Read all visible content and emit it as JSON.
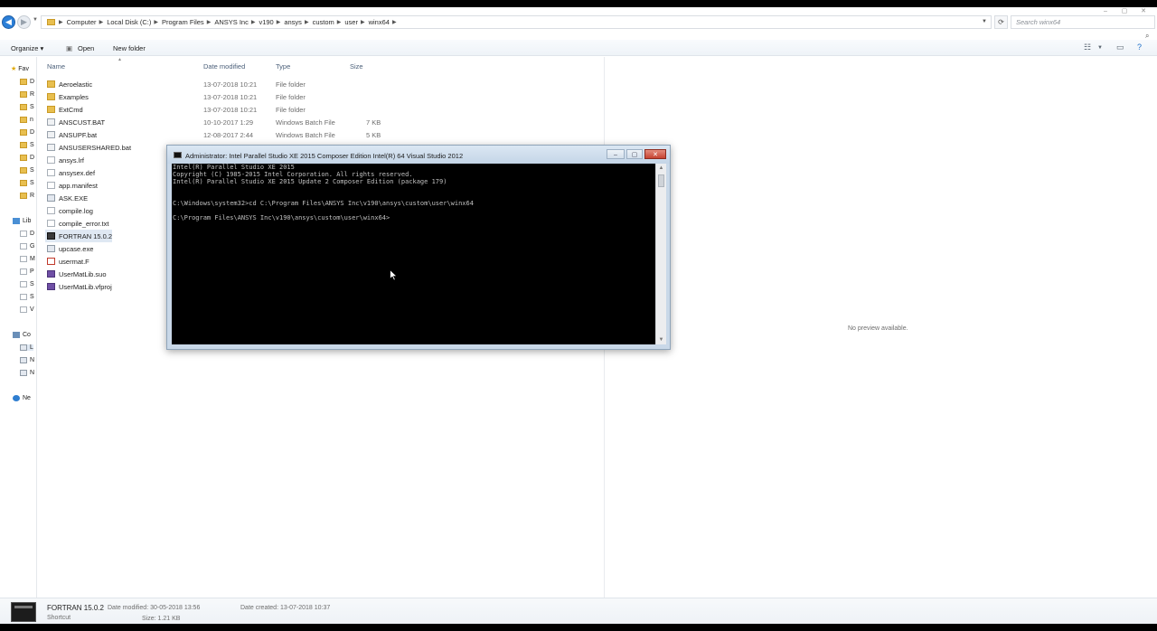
{
  "window": {
    "minimize": "–",
    "maximize": "▢",
    "close": "✕"
  },
  "breadcrumb": [
    "Computer",
    "Local Disk (C:)",
    "Program Files",
    "ANSYS Inc",
    "v190",
    "ansys",
    "custom",
    "user",
    "winx64"
  ],
  "search": {
    "placeholder": "Search winx64"
  },
  "toolbar": {
    "organize": "Organize ▾",
    "open": "Open",
    "new_folder": "New folder"
  },
  "nav_pane": [
    "Fav",
    "D",
    "R",
    "S",
    "n",
    "D",
    "S",
    "D",
    "S",
    "S",
    "R",
    "Lib",
    "D",
    "G",
    "M",
    "P",
    "S",
    "S",
    "V",
    "Co",
    "L",
    "N",
    "N",
    "Ne"
  ],
  "columns": {
    "name": "Name",
    "date": "Date modified",
    "type": "Type",
    "size": "Size"
  },
  "files": [
    {
      "name": "Aeroelastic",
      "date": "13-07-2018 10:21",
      "type": "File folder",
      "size": "",
      "icon": "folder"
    },
    {
      "name": "Examples",
      "date": "13-07-2018 10:21",
      "type": "File folder",
      "size": "",
      "icon": "folder"
    },
    {
      "name": "ExtCmd",
      "date": "13-07-2018 10:21",
      "type": "File folder",
      "size": "",
      "icon": "folder"
    },
    {
      "name": "ANSCUST.BAT",
      "date": "10-10-2017 1:29",
      "type": "Windows Batch File",
      "size": "7 KB",
      "icon": "bat"
    },
    {
      "name": "ANSUPF.bat",
      "date": "12-08-2017 2:44",
      "type": "Windows Batch File",
      "size": "5 KB",
      "icon": "bat"
    },
    {
      "name": "ANSUSERSHARED.bat",
      "date": "",
      "type": "",
      "size": "",
      "icon": "bat"
    },
    {
      "name": "ansys.lrf",
      "date": "",
      "type": "",
      "size": "",
      "icon": "file"
    },
    {
      "name": "ansysex.def",
      "date": "",
      "type": "",
      "size": "",
      "icon": "file"
    },
    {
      "name": "app.manifest",
      "date": "",
      "type": "",
      "size": "",
      "icon": "file"
    },
    {
      "name": "ASK.EXE",
      "date": "",
      "type": "",
      "size": "",
      "icon": "exe"
    },
    {
      "name": "compile.log",
      "date": "",
      "type": "",
      "size": "",
      "icon": "file"
    },
    {
      "name": "compile_error.txt",
      "date": "",
      "type": "",
      "size": "",
      "icon": "file"
    },
    {
      "name": "FORTRAN 15.0.2",
      "date": "",
      "type": "",
      "size": "",
      "icon": "fortran"
    },
    {
      "name": "upcase.exe",
      "date": "",
      "type": "",
      "size": "",
      "icon": "exe"
    },
    {
      "name": "usermat.F",
      "date": "",
      "type": "",
      "size": "",
      "icon": "fsrc"
    },
    {
      "name": "UserMatLib.suo",
      "date": "",
      "type": "",
      "size": "",
      "icon": "vs"
    },
    {
      "name": "UserMatLib.vfproj",
      "date": "",
      "type": "",
      "size": "",
      "icon": "vs"
    }
  ],
  "preview": {
    "message": "No preview available."
  },
  "details": {
    "name": "FORTRAN 15.0.2",
    "kind": "Shortcut",
    "modified": "Date modified: 30-05-2018 13:56",
    "created": "Date created: 13-07-2018 10:37",
    "size": "Size: 1.21 KB"
  },
  "console": {
    "title": "Administrator: Intel Parallel Studio XE 2015 Composer Edition Intel(R) 64 Visual Studio 2012",
    "lines": [
      "Intel(R) Parallel Studio XE 2015",
      "Copyright (C) 1985-2015 Intel Corporation. All rights reserved.",
      "Intel(R) Parallel Studio XE 2015 Update 2 Composer Edition (package 179)",
      "",
      "C:\\Windows\\system32>cd C:\\Program Files\\ANSYS Inc\\v190\\ansys\\custom\\user\\winx64",
      "",
      "C:\\Program Files\\ANSYS Inc\\v190\\ansys\\custom\\user\\winx64>"
    ]
  }
}
